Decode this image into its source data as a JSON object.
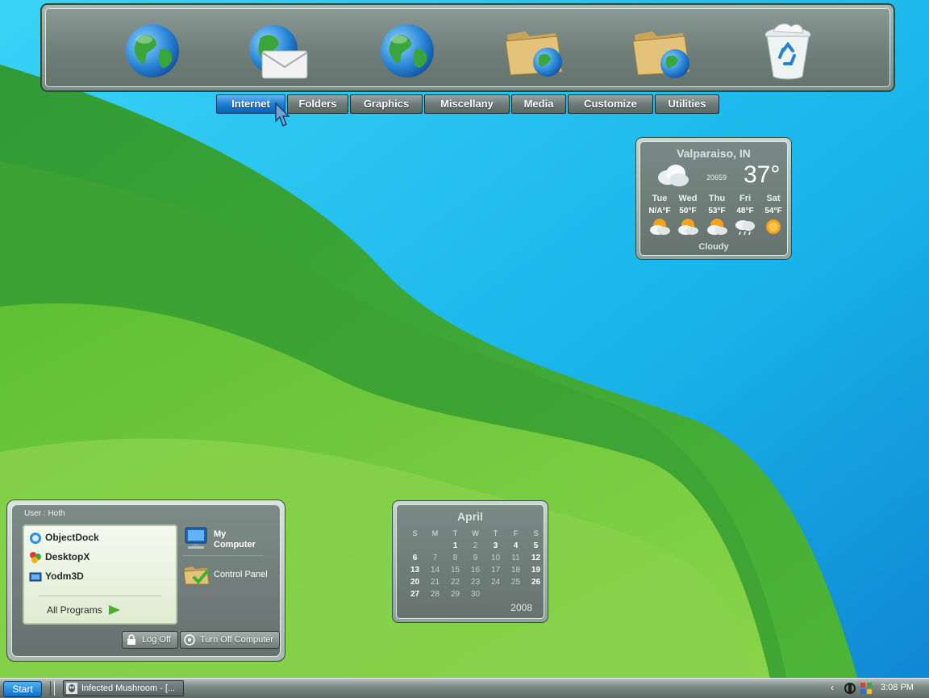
{
  "dock": {
    "items": [
      {
        "name": "internet-globe-icon"
      },
      {
        "name": "email-icon"
      },
      {
        "name": "browser-globe-icon"
      },
      {
        "name": "network-folder-icon"
      },
      {
        "name": "shared-folder-icon"
      },
      {
        "name": "recycle-bin-icon"
      }
    ]
  },
  "tabs": [
    {
      "label": "Internet",
      "active": true
    },
    {
      "label": "Folders"
    },
    {
      "label": "Graphics"
    },
    {
      "label": "Miscellany"
    },
    {
      "label": "Media"
    },
    {
      "label": "Customize"
    },
    {
      "label": "Utilities"
    }
  ],
  "weather": {
    "city": "Valparaiso, IN",
    "code": "20659",
    "temp": "37°",
    "condition": "Cloudy",
    "forecast": [
      {
        "day": "Tue",
        "temp": "N/A°F",
        "icon": "partly-cloudy-icon"
      },
      {
        "day": "Wed",
        "temp": "50°F",
        "icon": "partly-cloudy-icon"
      },
      {
        "day": "Thu",
        "temp": "53°F",
        "icon": "partly-cloudy-icon"
      },
      {
        "day": "Fri",
        "temp": "48°F",
        "icon": "rain-icon"
      },
      {
        "day": "Sat",
        "temp": "54°F",
        "icon": "sun-icon"
      }
    ]
  },
  "startmenu": {
    "user_label": "User :  Hoth",
    "programs": [
      {
        "label": "ObjectDock",
        "icon": "objectdock-icon"
      },
      {
        "label": "DesktopX",
        "icon": "desktopx-icon"
      },
      {
        "label": "Yodm3D",
        "icon": "yodm3d-icon"
      }
    ],
    "all_programs": "All Programs",
    "my_computer_1": "My",
    "my_computer_2": "Computer",
    "control_panel": "Control Panel",
    "log_off": "Log Off",
    "turn_off": "Turn Off Computer"
  },
  "calendar": {
    "month": "April",
    "year": "2008",
    "weekdays": [
      "S",
      "M",
      "T",
      "W",
      "T",
      "F",
      "S"
    ],
    "rows": [
      [
        "",
        "",
        "1",
        "2",
        "3",
        "4",
        "5"
      ],
      [
        "6",
        "7",
        "8",
        "9",
        "10",
        "11",
        "12"
      ],
      [
        "13",
        "14",
        "15",
        "16",
        "17",
        "18",
        "19"
      ],
      [
        "20",
        "21",
        "22",
        "23",
        "24",
        "25",
        "26"
      ],
      [
        "27",
        "28",
        "29",
        "30",
        "",
        "",
        ""
      ]
    ]
  },
  "taskbar": {
    "start": "Start",
    "task_label": "Infected Mushroom - [...",
    "tray_arrow": "‹",
    "clock": "3:08 PM"
  },
  "colors": {
    "accent_blue": "#1f7fd3",
    "panel_gray": "#707f7a",
    "wallpaper_green": "#6fcb3a",
    "wallpaper_blue": "#1cc0ee"
  }
}
